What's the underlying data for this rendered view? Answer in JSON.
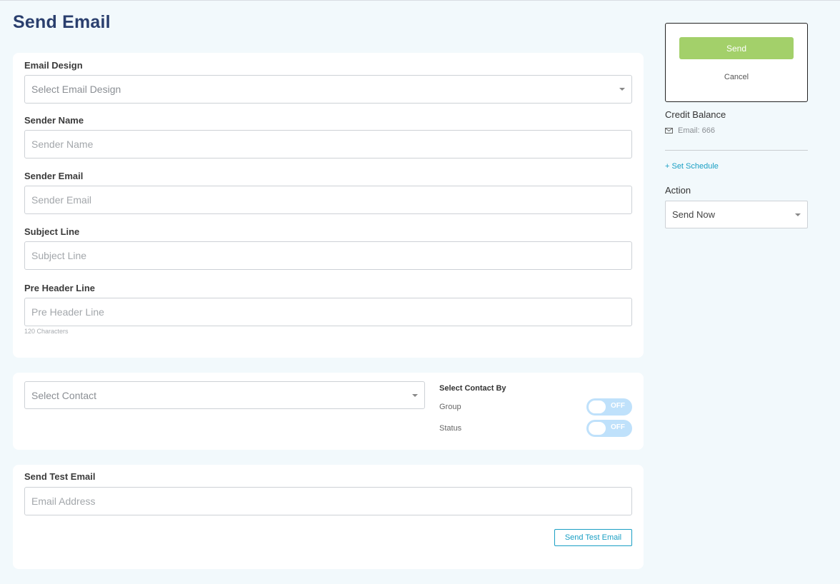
{
  "page": {
    "title": "Send Email"
  },
  "form": {
    "email_design": {
      "label": "Email Design",
      "placeholder": "Select Email Design"
    },
    "sender_name": {
      "label": "Sender Name",
      "placeholder": "Sender Name"
    },
    "sender_email": {
      "label": "Sender Email",
      "placeholder": "Sender Email"
    },
    "subject_line": {
      "label": "Subject Line",
      "placeholder": "Subject Line"
    },
    "pre_header": {
      "label": "Pre Header Line",
      "placeholder": "Pre Header Line",
      "hint": "120 Characters"
    }
  },
  "contacts": {
    "select_placeholder": "Select Contact",
    "select_by_title": "Select Contact By",
    "toggles": [
      {
        "label": "Group",
        "state": "OFF"
      },
      {
        "label": "Status",
        "state": "OFF"
      }
    ]
  },
  "test_email": {
    "label": "Send Test Email",
    "placeholder": "Email Address",
    "button": "Send Test Email"
  },
  "sidebar": {
    "send_button": "Send",
    "cancel_button": "Cancel",
    "credit_title": "Credit Balance",
    "credit_email": "Email: 666",
    "set_schedule": "+ Set Schedule",
    "action_label": "Action",
    "action_value": "Send Now"
  },
  "colors": {
    "title": "#2a3f6e",
    "send_button": "#a3d06a",
    "link": "#1a9fc4",
    "toggle_off": "#bfe1fb",
    "background": "#f2f9fc"
  }
}
